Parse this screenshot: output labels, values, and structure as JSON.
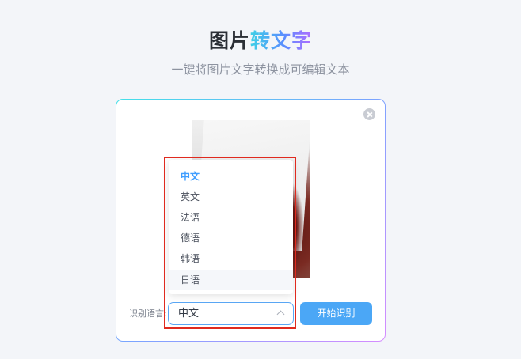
{
  "header": {
    "title_part1": "图片",
    "title_part2": "转文字",
    "subtitle": "一键将图片文字转换成可编辑文本"
  },
  "card": {
    "language_label": "识别语言:",
    "selected_language": "中文",
    "start_button_label": "开始识别"
  },
  "dropdown": {
    "options": [
      {
        "label": "中文",
        "selected": true
      },
      {
        "label": "英文",
        "selected": false
      },
      {
        "label": "法语",
        "selected": false
      },
      {
        "label": "德语",
        "selected": false
      },
      {
        "label": "韩语",
        "selected": false
      },
      {
        "label": "日语",
        "selected": false,
        "hovered": true
      }
    ]
  },
  "colors": {
    "accent": "#409eff",
    "button": "#4ba7f6",
    "highlight": "#e02a1f"
  }
}
